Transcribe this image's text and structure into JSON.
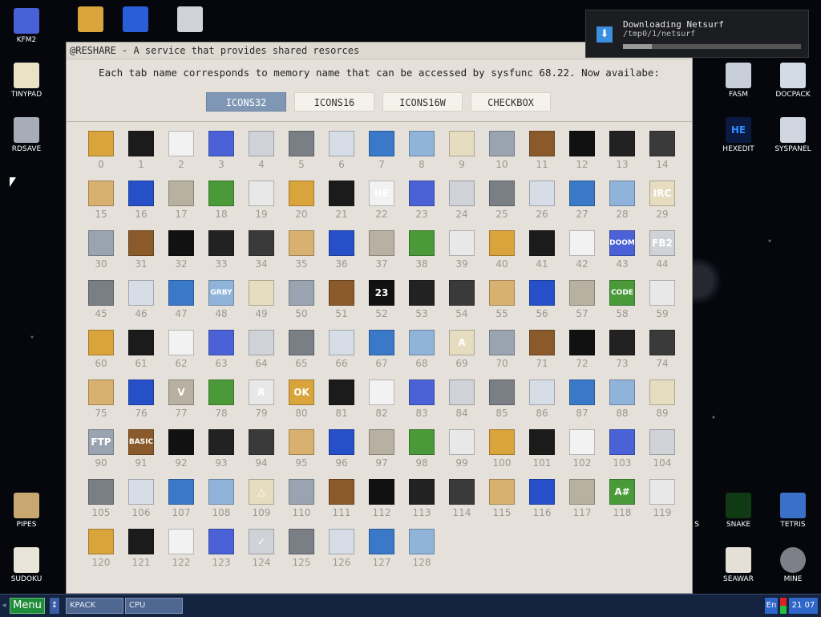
{
  "window": {
    "title": "@RESHARE - A service that provides shared resorces",
    "description": "Each tab name corresponds to memory name that can be accessed by sysfunc 68.22. Now availabe:",
    "tabs": [
      {
        "label": "ICONS32",
        "active": true
      },
      {
        "label": "ICONS16",
        "active": false
      },
      {
        "label": "ICONS16W",
        "active": false
      },
      {
        "label": "CHECKBOX",
        "active": false
      }
    ]
  },
  "icon_grid": {
    "labels": [
      "0",
      "1",
      "2",
      "3",
      "4",
      "5",
      "6",
      "7",
      "8",
      "9",
      "10",
      "11",
      "12",
      "13",
      "14",
      "15",
      "16",
      "17",
      "18",
      "19",
      "20",
      "21",
      "22",
      "23",
      "24",
      "25",
      "26",
      "27",
      "28",
      "29",
      "30",
      "31",
      "32",
      "33",
      "34",
      "35",
      "36",
      "37",
      "38",
      "39",
      "40",
      "41",
      "42",
      "43",
      "44",
      "45",
      "46",
      "47",
      "48",
      "49",
      "50",
      "51",
      "52",
      "53",
      "54",
      "55",
      "56",
      "57",
      "58",
      "59",
      "60",
      "61",
      "62",
      "63",
      "64",
      "65",
      "66",
      "67",
      "68",
      "69",
      "70",
      "71",
      "72",
      "73",
      "74",
      "75",
      "76",
      "77",
      "78",
      "79",
      "80",
      "81",
      "82",
      "83",
      "84",
      "85",
      "86",
      "87",
      "88",
      "89",
      "90",
      "91",
      "92",
      "93",
      "94",
      "95",
      "96",
      "97",
      "98",
      "99",
      "100",
      "101",
      "102",
      "103",
      "104",
      "105",
      "106",
      "107",
      "108",
      "109",
      "110",
      "111",
      "112",
      "113",
      "114",
      "115",
      "116",
      "117",
      "118",
      "119",
      "120",
      "121",
      "122",
      "123",
      "124",
      "125",
      "126",
      "127",
      "128"
    ],
    "glyphs": {
      "22": "HE",
      "29": "IRC",
      "43": "DOOM",
      "44": "FB2",
      "48": "GRBY",
      "52": "23",
      "58": "CODE",
      "69": "A",
      "77": "V",
      "79": "R",
      "80": "OK",
      "90": "FTP",
      "91": "BASIC",
      "109": "△",
      "118": "A#",
      "124": "✓"
    }
  },
  "notification": {
    "title": "Downloading Netsurf",
    "path": "/tmp0/1/netsurf",
    "progress": 0.16
  },
  "desktop_icons": {
    "kfm2": "KFM2",
    "tinypad": "TINYPAD",
    "rdsave": "RDSAVE",
    "pipes": "PIPES",
    "sudoku": "SUDOKU",
    "fasm": "FASM",
    "docpack": "DOCPACK",
    "hexedit": "HEXEDIT",
    "sysppanel": "SYSPANEL",
    "snake": "SNAKE",
    "tetris": "TETRIS",
    "seawar": "SEAWAR",
    "mine": "MINE",
    "partial_s": "S",
    "hexedit_glyph": "HE"
  },
  "taskbar": {
    "menu_label": "Menu",
    "arrow": "↕",
    "left_arrow": "◂",
    "tasks": [
      "KPACK",
      "CPU"
    ],
    "lang": "En",
    "clock": "21 07"
  },
  "colors": {
    "active_tab": "#7f97b4",
    "window_bg": "#e5e1da",
    "taskbar_bg": "#14233f",
    "menu_green": "#1f8c3a"
  }
}
